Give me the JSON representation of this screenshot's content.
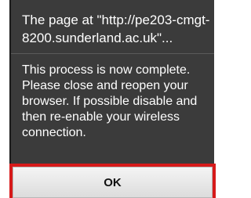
{
  "dialog": {
    "title": "The page at \"http://pe203-cmgt-8200.sunderland.ac.uk\"...",
    "message": "This process is now complete. Please close and reopen your browser. If possible disable and then re-enable your wireless connection.",
    "ok_label": "OK"
  }
}
